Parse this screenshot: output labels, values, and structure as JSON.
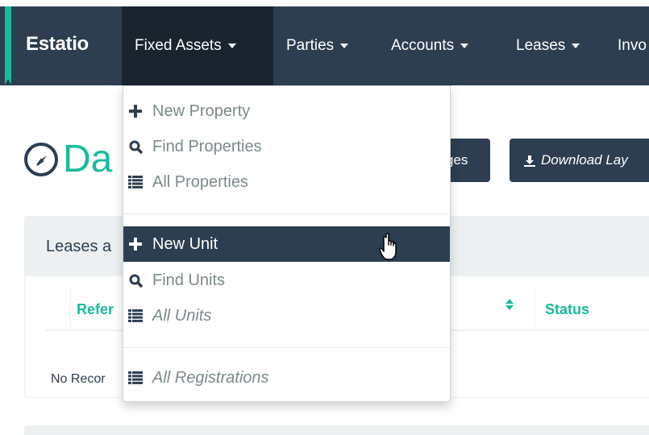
{
  "navbar": {
    "brand": "Estatio",
    "items": [
      {
        "label": "Fixed Assets",
        "active": true
      },
      {
        "label": "Parties"
      },
      {
        "label": "Accounts"
      },
      {
        "label": "Leases"
      },
      {
        "label": "Invo"
      }
    ]
  },
  "page": {
    "title": "Da",
    "title_icon": "compass-icon",
    "buttons": {
      "changes_label": "ges",
      "download_label": "Download Lay",
      "download_icon": "download-icon"
    }
  },
  "panel": {
    "heading": "Leases a",
    "columns": {
      "reference": "Refer",
      "status": "Status"
    },
    "empty_text": "No Recor"
  },
  "dropdown": {
    "sections": [
      {
        "items": [
          {
            "label": "New Property",
            "icon": "plus-icon"
          },
          {
            "label": "Find Properties",
            "icon": "search-icon"
          },
          {
            "label": "All Properties",
            "icon": "list-icon"
          }
        ]
      },
      {
        "items": [
          {
            "label": "New Unit",
            "icon": "plus-icon",
            "hovered": true
          },
          {
            "label": "Find Units",
            "icon": "search-icon"
          },
          {
            "label": "All Units",
            "icon": "list-icon",
            "italic": true
          }
        ]
      },
      {
        "items": [
          {
            "label": "All Registrations",
            "icon": "list-icon",
            "italic": true
          }
        ]
      }
    ]
  },
  "colors": {
    "navbar": "#2c3e50",
    "navbar_active": "#1a242f",
    "accent": "#18bc9c",
    "menu_text": "#7b8a8b",
    "panel_heading_bg": "#ecf0f1"
  }
}
